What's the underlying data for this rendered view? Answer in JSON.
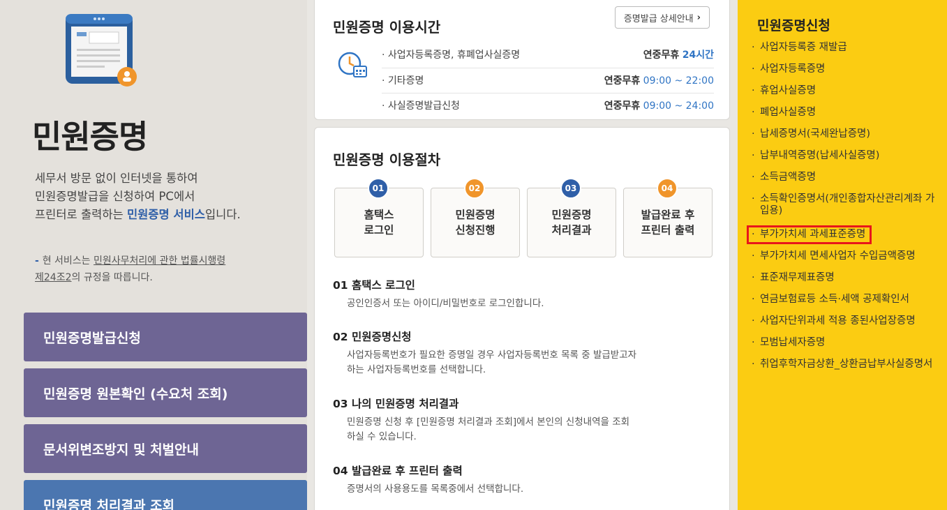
{
  "left": {
    "title": "민원증명",
    "desc_1": "세무서 방문 없이 인터넷을 통하여",
    "desc_2": "민원증명발급을 신청하여 PC에서",
    "desc_3a": "프린터로 출력하는 ",
    "desc_3b": "민원증명 서비스",
    "desc_3c": "입니다.",
    "notice_1a": "현 서비스는 ",
    "notice_1b": "민원사무처리에 관한 법률시행령",
    "notice_2a": "제24조2",
    "notice_2b": "의 규정을 따릅니다.",
    "buttons": [
      "민원증명발급신청",
      "민원증명 원본확인 (수요처 조회)",
      "문서위변조방지 및 처벌안내",
      "민원증명 처리결과 조회"
    ]
  },
  "hours": {
    "title": "민원증명 이용시간",
    "detail_btn": "증명발급 상세안내",
    "rows": [
      {
        "name": "· 사업자등록증명, 휴폐업사실증명",
        "days": "연중무휴",
        "time": "24시간"
      },
      {
        "name": "· 기타증명",
        "days": "연중무휴",
        "time": "09:00 ~ 22:00"
      },
      {
        "name": "· 사실증명발급신청",
        "days": "연중무휴",
        "time": "09:00 ~ 24:00"
      }
    ]
  },
  "procedure": {
    "title": "민원증명 이용절차",
    "steps": [
      {
        "num": "01",
        "l1": "홈택스",
        "l2": "로그인"
      },
      {
        "num": "02",
        "l1": "민원증명",
        "l2": "신청진행"
      },
      {
        "num": "03",
        "l1": "민원증명",
        "l2": "처리결과"
      },
      {
        "num": "04",
        "l1": "발급완료 후",
        "l2": "프린터 출력"
      }
    ],
    "sections": [
      {
        "head": "01 홈택스 로그인",
        "body1": "공인인증서 또는 아이디/비밀번호로 로그인합니다.",
        "body2": ""
      },
      {
        "head": "02 민원증명신청",
        "body1": "사업자등록번호가 필요한 증명일 경우 사업자등록번호 목록 중 발급받고자",
        "body2": "하는 사업자등록번호를 선택합니다."
      },
      {
        "head": "03 나의 민원증명 처리결과",
        "body1": "민원증명 신청 후 [민원증명 처리결과 조회]에서 본인의 신청내역을 조회",
        "body2": "하실 수 있습니다."
      },
      {
        "head": "04 발급완료 후 프린터 출력",
        "body1": "증명서의 사용용도를 목록중에서 선택합니다.",
        "body2": ""
      }
    ]
  },
  "apply": {
    "title": "민원증명신청",
    "items": [
      "사업자등록증 재발급",
      "사업자등록증명",
      "휴업사실증명",
      "폐업사실증명",
      "납세증명서(국세완납증명)",
      "납부내역증명(납세사실증명)",
      "소득금액증명",
      "소득확인증명서(개인종합자산관리계좌 가입용)",
      "부가가치세 과세표준증명",
      "부가가치세 면세사업자 수입금액증명",
      "표준재무제표증명",
      "연금보험료등 소득·세액 공제확인서",
      "사업자단위과세 적용 종된사업장증명",
      "모범납세자증명",
      "취업후학자금상환_상환금납부사실증명서"
    ],
    "selected_index": 8
  },
  "colors": {
    "accent_blue": "#2f5fa8",
    "yellow": "#fbcc12",
    "purple_btn": "#6e6594",
    "orange": "#f0952b",
    "highlight_red": "#e8161b"
  }
}
